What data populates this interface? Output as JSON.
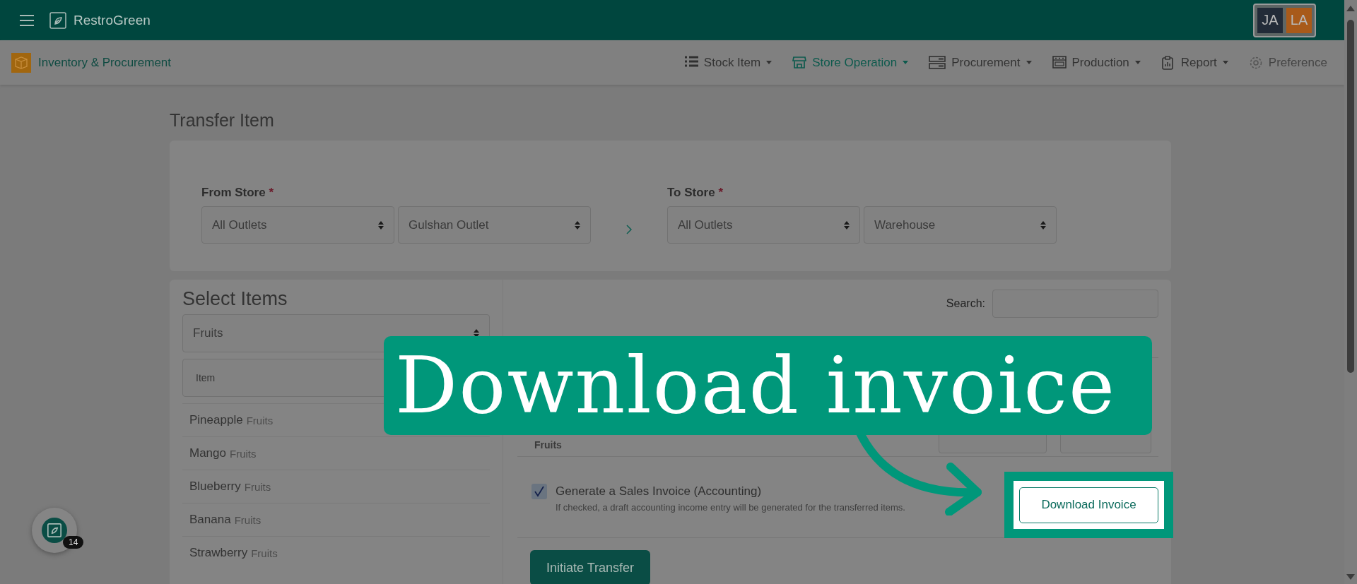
{
  "app": {
    "brand": "RestroGreen",
    "users": [
      {
        "initials": "JA",
        "color": "#222b38"
      },
      {
        "initials": "LA",
        "color": "#a85a1a"
      }
    ]
  },
  "module": {
    "title": "Inventory & Procurement"
  },
  "nav": [
    {
      "label": "Stock Item",
      "kind": "list",
      "selected": false,
      "dropdown": true
    },
    {
      "label": "Store Operation",
      "kind": "store",
      "selected": true,
      "dropdown": true
    },
    {
      "label": "Procurement",
      "kind": "servers",
      "selected": false,
      "dropdown": true
    },
    {
      "label": "Production",
      "kind": "oven",
      "selected": false,
      "dropdown": true
    },
    {
      "label": "Report",
      "kind": "clipboard",
      "selected": false,
      "dropdown": true
    },
    {
      "label": "Preference",
      "kind": "gear",
      "selected": false,
      "dropdown": false
    }
  ],
  "page_title": "Transfer Item",
  "stores": [
    {
      "label": "From Store",
      "required_mark": "*",
      "selects": [
        "All Outlets",
        "Gulshan Outlet"
      ]
    },
    {
      "label": "To Store",
      "required_mark": "*",
      "selects": [
        "All Outlets",
        "Warehouse"
      ]
    }
  ],
  "select_items": {
    "title": "Select Items",
    "category": "Fruits",
    "search_placeholder": "Item",
    "items": [
      {
        "name": "Pineapple",
        "category": "Fruits"
      },
      {
        "name": "Mango",
        "category": "Fruits"
      },
      {
        "name": "Blueberry",
        "category": "Fruits"
      },
      {
        "name": "Banana",
        "category": "Fruits"
      },
      {
        "name": "Strawberry",
        "category": "Fruits"
      }
    ]
  },
  "table": {
    "search_label": "Search:",
    "rows": [
      {
        "category": "Fruits"
      }
    ]
  },
  "invoice": {
    "checked": true,
    "label": "Generate a Sales Invoice (Accounting)",
    "hint": "If checked, a draft accounting income entry will be generated for the transferred items."
  },
  "download_button": "Download Invoice",
  "initiate_button": "Initiate Transfer",
  "callout": {
    "text": "Download invoice"
  },
  "chat": {
    "badge": "14"
  }
}
